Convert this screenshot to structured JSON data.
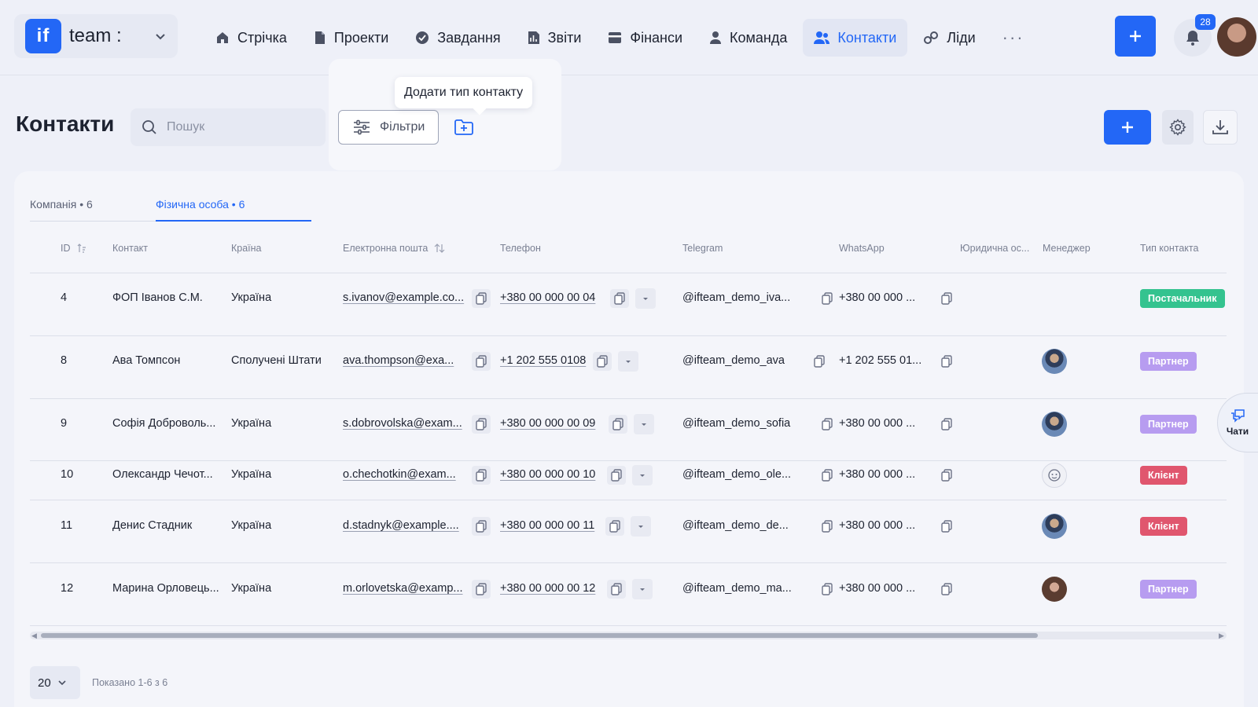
{
  "app": {
    "logo_text": "if",
    "workspace": "team :"
  },
  "nav": [
    {
      "label": "Стрічка",
      "icon": "home-icon"
    },
    {
      "label": "Проекти",
      "icon": "file-icon"
    },
    {
      "label": "Завдання",
      "icon": "check-circle-icon"
    },
    {
      "label": "Звіти",
      "icon": "chart-icon"
    },
    {
      "label": "Фінанси",
      "icon": "wallet-icon"
    },
    {
      "label": "Команда",
      "icon": "user-icon"
    },
    {
      "label": "Контакти",
      "icon": "users-icon",
      "active": true
    },
    {
      "label": "Ліди",
      "icon": "link-icon"
    }
  ],
  "nav_more": "···",
  "notifications": {
    "count": "28"
  },
  "page": {
    "title": "Контакти",
    "search_placeholder": "Пошук",
    "filters_label": "Фільтри",
    "tooltip": "Додати тип контакту"
  },
  "tabs": [
    {
      "label": "Компанія • 6"
    },
    {
      "label": "Фізична особа • 6",
      "active": true
    }
  ],
  "columns": {
    "id": "ID",
    "contact": "Контакт",
    "country": "Країна",
    "email": "Електронна пошта",
    "phone": "Телефон",
    "telegram": "Telegram",
    "whatsapp": "WhatsApp",
    "legal": "Юридична ос...",
    "manager": "Менеджер",
    "type": "Тип контакта"
  },
  "rows": [
    {
      "id": "4",
      "contact": "ФОП Іванов С.М.",
      "country": "Україна",
      "email": "s.ivanov@example.co...",
      "phone": "+380 00 000 00 04",
      "telegram": "@ifteam_demo_iva...",
      "whatsapp": "+380 00 000 ...",
      "manager": "",
      "type": "Постачальник",
      "type_color": "#34c38f"
    },
    {
      "id": "8",
      "contact": "Ава Томпсон",
      "country": "Сполучені Штати",
      "email": "ava.thompson@exa...",
      "phone": "+1 202 555 0108",
      "telegram": "@ifteam_demo_ava",
      "whatsapp": "+1 202 555 01...",
      "manager": "man",
      "type": "Партнер",
      "type_color": "#b79cf0"
    },
    {
      "id": "9",
      "contact": "Софія Доброволь...",
      "country": "Україна",
      "email": "s.dobrovolska@exam...",
      "phone": "+380 00 000 00 09",
      "telegram": "@ifteam_demo_sofia",
      "whatsapp": "+380 00 000 ...",
      "manager": "man",
      "type": "Партнер",
      "type_color": "#b79cf0"
    },
    {
      "id": "10",
      "contact": "Олександр Чечот...",
      "country": "Україна",
      "email": "o.chechotkin@exam...",
      "phone": "+380 00 000 00 10",
      "telegram": "@ifteam_demo_ole...",
      "whatsapp": "+380 00 000 ...",
      "manager": "icon",
      "type": "Клієнт",
      "type_color": "#e0566e"
    },
    {
      "id": "11",
      "contact": "Денис Стадник",
      "country": "Україна",
      "email": "d.stadnyk@example....",
      "phone": "+380 00 000 00 11",
      "telegram": "@ifteam_demo_de...",
      "whatsapp": "+380 00 000 ...",
      "manager": "man",
      "type": "Клієнт",
      "type_color": "#e0566e"
    },
    {
      "id": "12",
      "contact": "Марина Орловець...",
      "country": "Україна",
      "email": "m.orlovetska@examp...",
      "phone": "+380 00 000 00 12",
      "telegram": "@ifteam_demo_ma...",
      "whatsapp": "+380 00 000 ...",
      "manager": "woman",
      "type": "Партнер",
      "type_color": "#b79cf0"
    }
  ],
  "pagination": {
    "page_size": "20",
    "info": "Показано 1-6 з 6"
  },
  "chats": {
    "label": "Чати"
  },
  "colors": {
    "accent": "#2367f6",
    "background": "#eef0f8",
    "card": "#f4f5fa"
  }
}
